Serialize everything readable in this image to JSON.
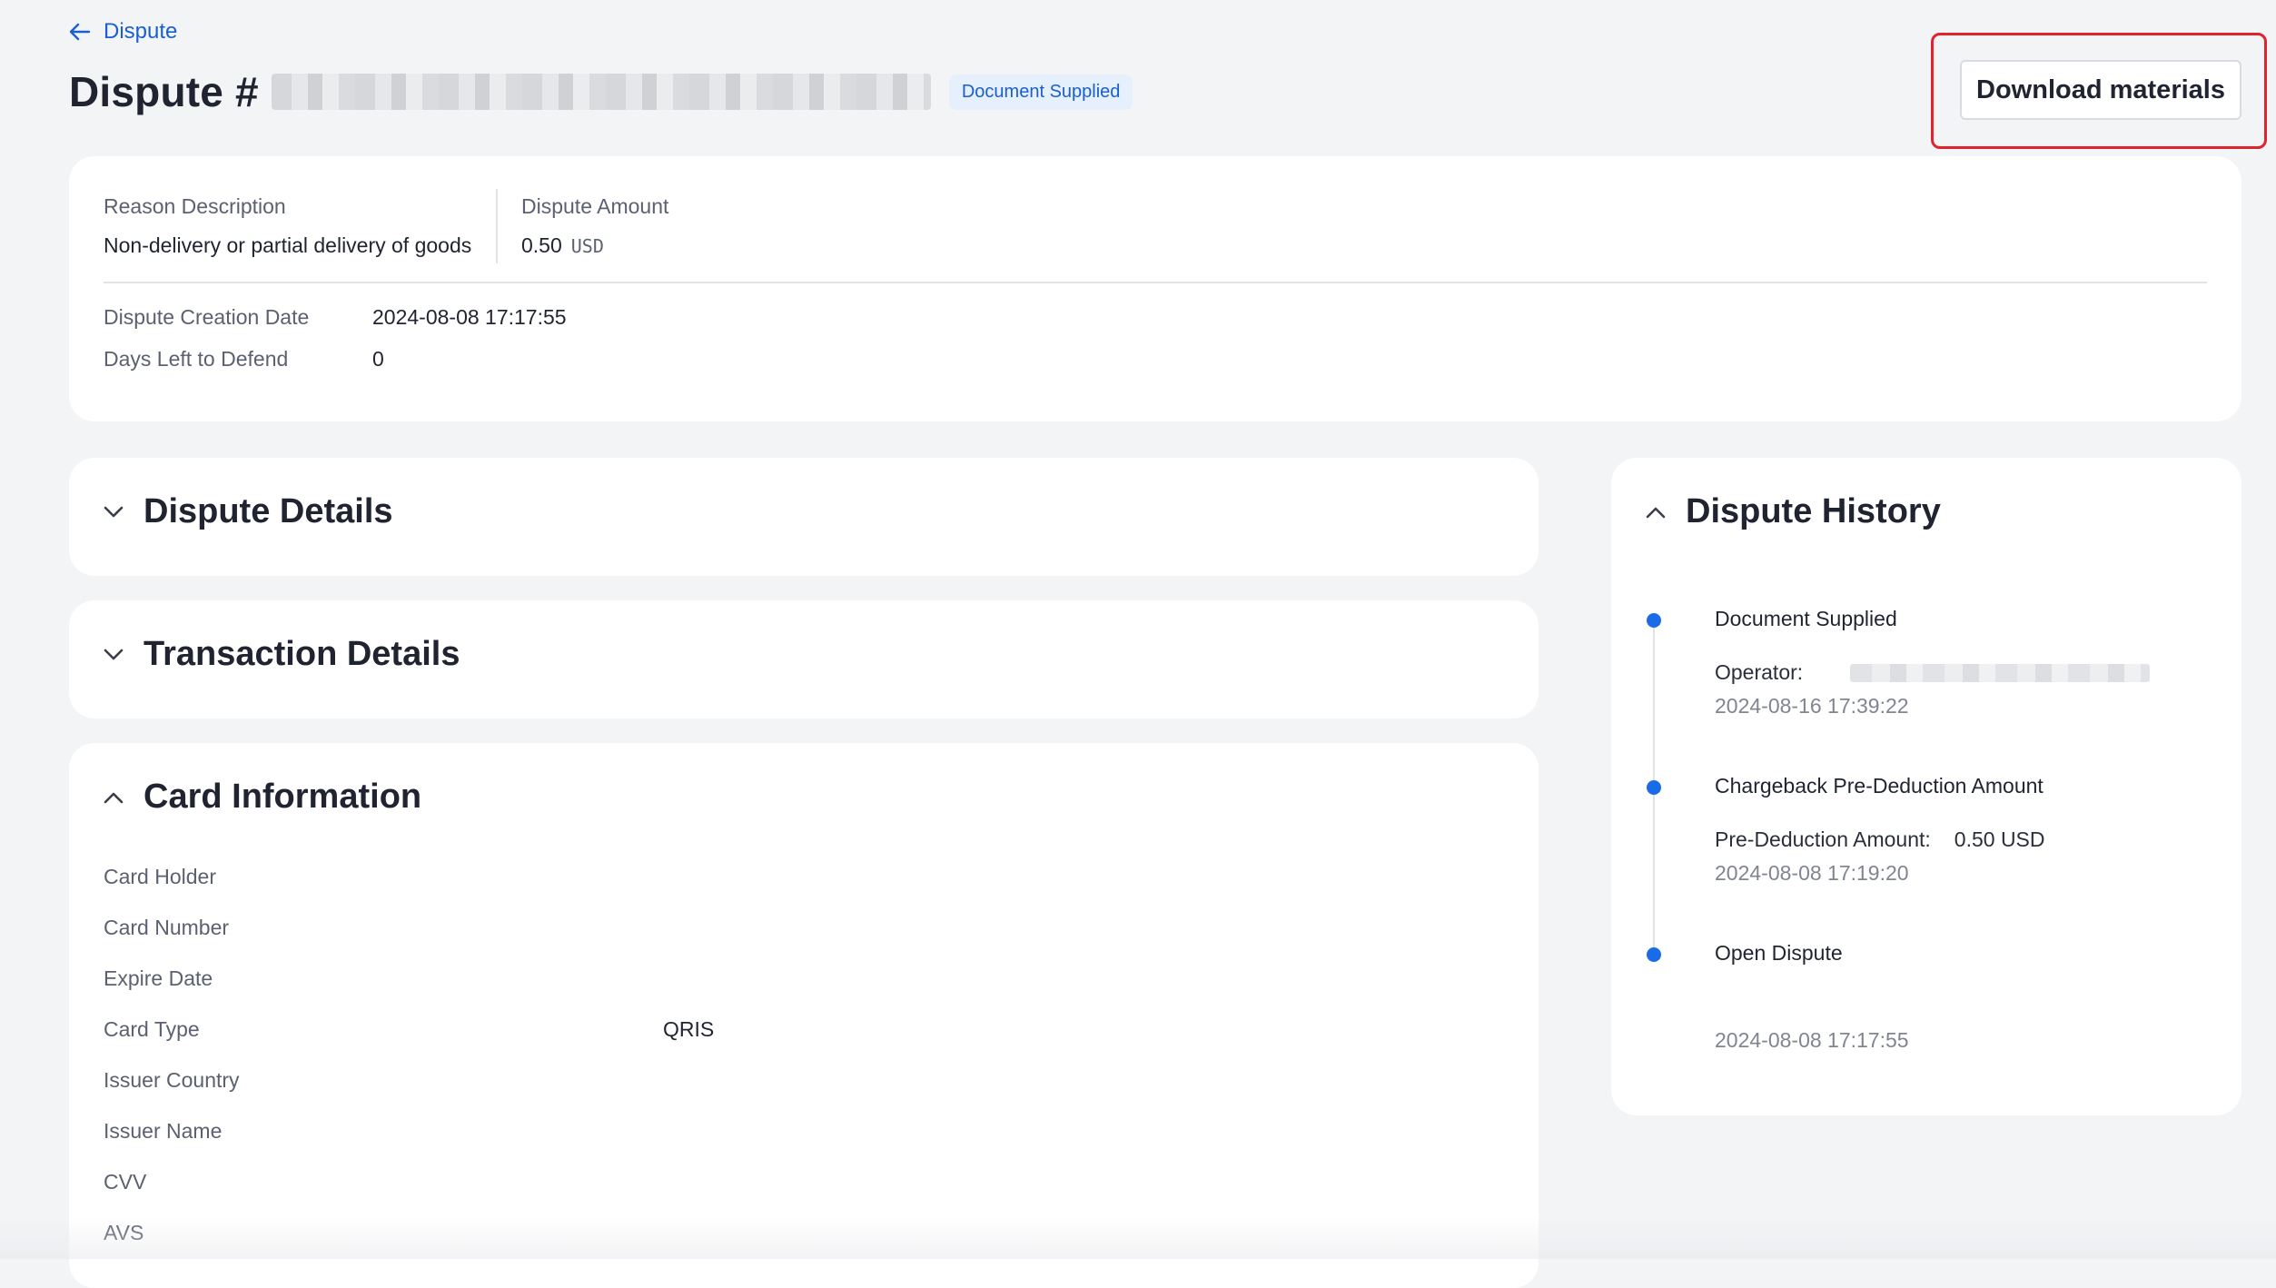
{
  "breadcrumb": {
    "back_label": "Dispute"
  },
  "header": {
    "title": "Dispute #",
    "status_badge": "Document Supplied",
    "download_label": "Download materials"
  },
  "summary": {
    "reason_label": "Reason Description",
    "reason_value": "Non-delivery or partial delivery of goods",
    "amount_label": "Dispute Amount",
    "amount_value": "0.50",
    "amount_currency": "USD",
    "creation_label": "Dispute Creation Date",
    "creation_value": "2024-08-08 17:17:55",
    "days_left_label": "Days Left to Defend",
    "days_left_value": "0"
  },
  "sections": {
    "dispute_details": "Dispute Details",
    "transaction_details": "Transaction Details",
    "card_information": "Card Information"
  },
  "card_info": {
    "rows": [
      {
        "label": "Card Holder",
        "value": ""
      },
      {
        "label": "Card Number",
        "value": ""
      },
      {
        "label": "Expire Date",
        "value": ""
      },
      {
        "label": "Card Type",
        "value": "QRIS"
      },
      {
        "label": "Issuer Country",
        "value": ""
      },
      {
        "label": "Issuer Name",
        "value": ""
      },
      {
        "label": "CVV",
        "value": ""
      },
      {
        "label": "AVS",
        "value": ""
      }
    ]
  },
  "history": {
    "title": "Dispute History",
    "events": [
      {
        "event": "Document Supplied",
        "detail_key": "Operator:",
        "detail_value": "",
        "time": "2024-08-16 17:39:22"
      },
      {
        "event": "Chargeback Pre-Deduction Amount",
        "detail_key": "Pre-Deduction Amount:",
        "detail_value": "0.50 USD",
        "time": "2024-08-08 17:19:20"
      },
      {
        "event": "Open Dispute",
        "detail_key": "",
        "detail_value": "",
        "time": "2024-08-08 17:17:55"
      }
    ]
  },
  "colors": {
    "accent": "#1a5fd0",
    "timeline_dot": "#1a6be8",
    "highlight": "#e3232c",
    "page_bg": "#f3f4f6"
  }
}
